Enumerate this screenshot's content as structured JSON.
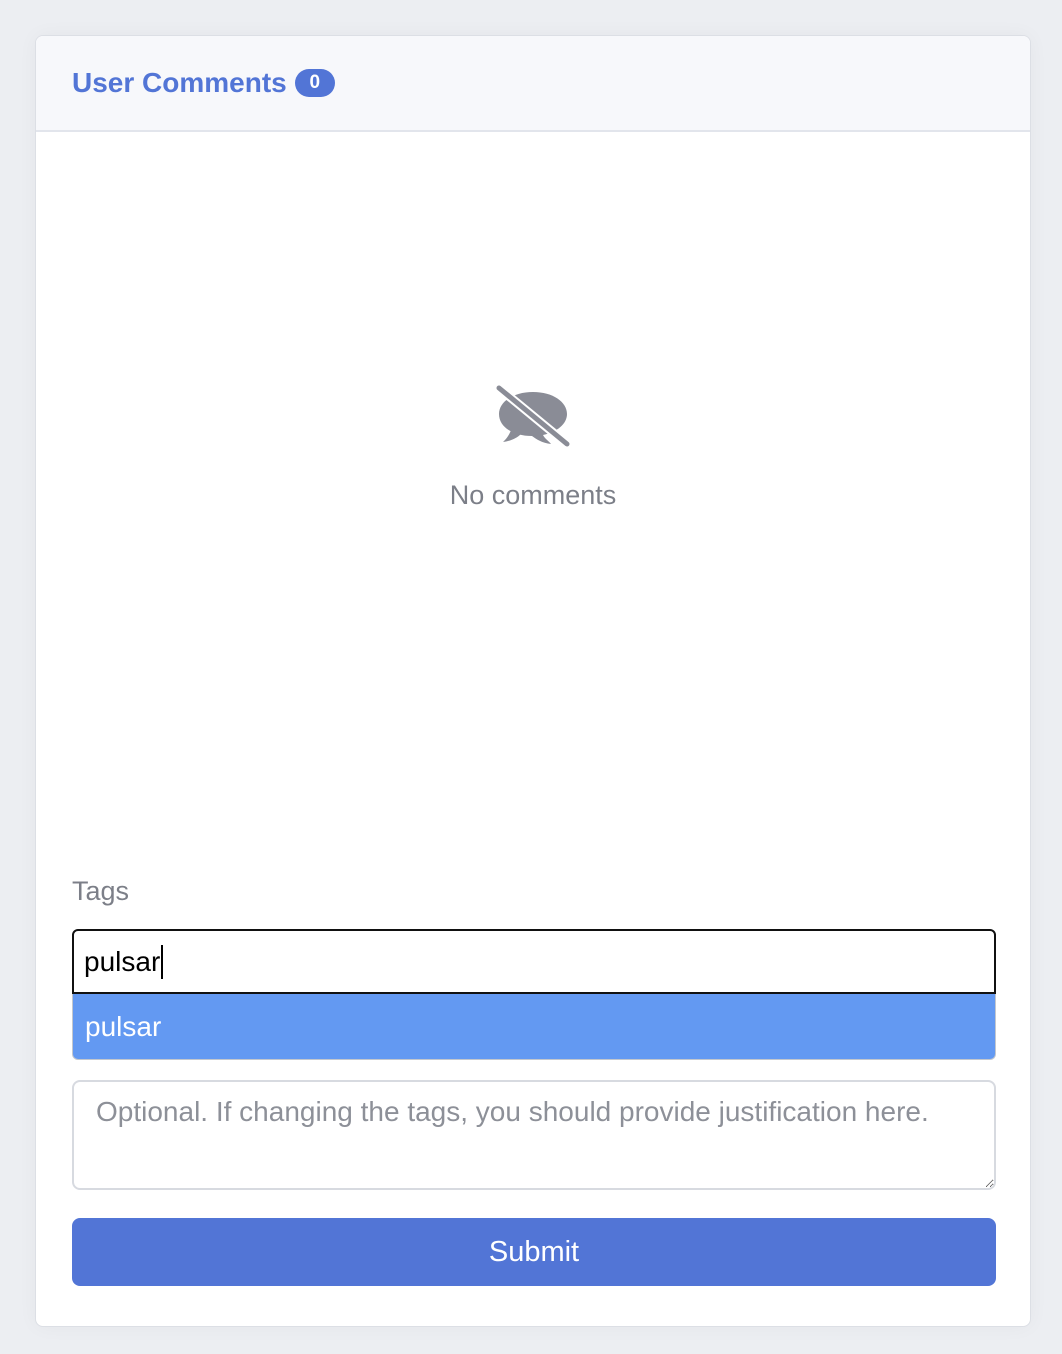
{
  "header": {
    "title": "User Comments",
    "count": "0"
  },
  "empty_state": {
    "icon": "comment-slash-icon",
    "text": "No comments"
  },
  "tags": {
    "label": "Tags",
    "input_value": "pulsar",
    "suggestions": [
      "pulsar"
    ]
  },
  "justification": {
    "placeholder": "Optional. If changing the tags, you should provide justification here.",
    "value": ""
  },
  "submit": {
    "label": "Submit"
  },
  "colors": {
    "accent": "#5275d6",
    "dropdown_highlight": "#6399f2",
    "muted_text": "#7c7f88"
  }
}
